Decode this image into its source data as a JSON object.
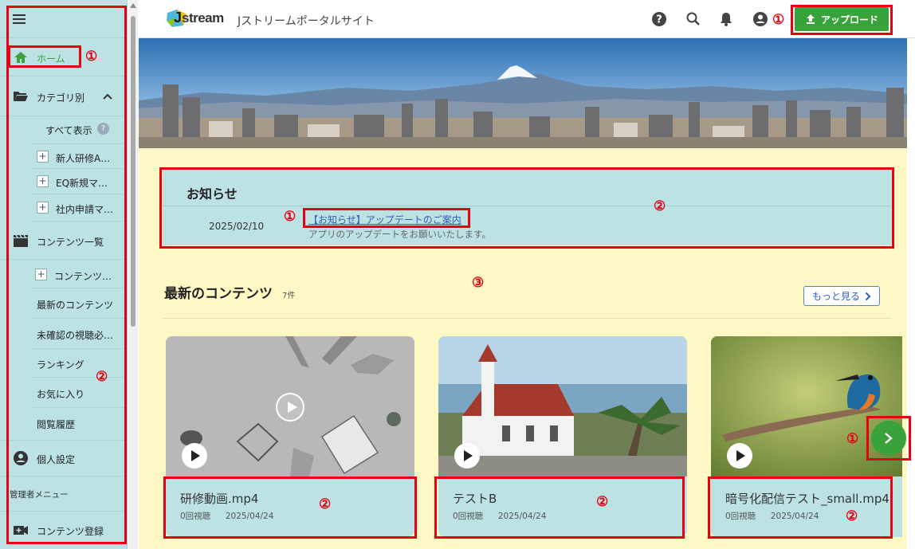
{
  "sidebar": {
    "home": "ホーム",
    "category": "カテゴリ別",
    "show_all": "すべて表示",
    "cat_items": [
      "新人研修A…",
      "EQ新規マ…",
      "社内申請マ…"
    ],
    "contents_list": "コンテンツ一覧",
    "contents_sub": "コンテンツ…",
    "latest": "最新のコンテンツ",
    "unconfirmed": "未確認の視聴必…",
    "ranking": "ランキング",
    "favorites": "お気に入り",
    "history": "閲覧履歴",
    "personal": "個人設定",
    "admin_menu": "管理者メニュー",
    "content_register": "コンテンツ登録"
  },
  "header": {
    "logo_text": "stream",
    "logo_letter": "J",
    "site_title": "Jストリームポータルサイト",
    "upload": "アップロード"
  },
  "notice": {
    "title": "お知らせ",
    "date": "2025/02/10",
    "link": "【お知らせ】アップデートのご案内",
    "desc": "アプリのアップデートをお願いいたします。"
  },
  "latest": {
    "title": "最新のコンテンツ",
    "count": "7件",
    "more": "もっと見る"
  },
  "cards": [
    {
      "title": "研修動画.mp4",
      "views": "0回視聴",
      "date": "2025/04/24"
    },
    {
      "title": "テストB",
      "views": "0回視聴",
      "date": "2025/04/24"
    },
    {
      "title": "暗号化配信テスト_small.mp4",
      "views": "0回視聴",
      "date": "2025/04/24"
    }
  ],
  "annotations": {
    "one": "①",
    "two": "②",
    "three": "③"
  },
  "colors": {
    "sidebar_bg": "#bde2e4",
    "main_bg": "#fff8c5",
    "accent_green": "#3aa23a",
    "annotation_red": "#e60012",
    "link_blue": "#2b5fb8"
  }
}
